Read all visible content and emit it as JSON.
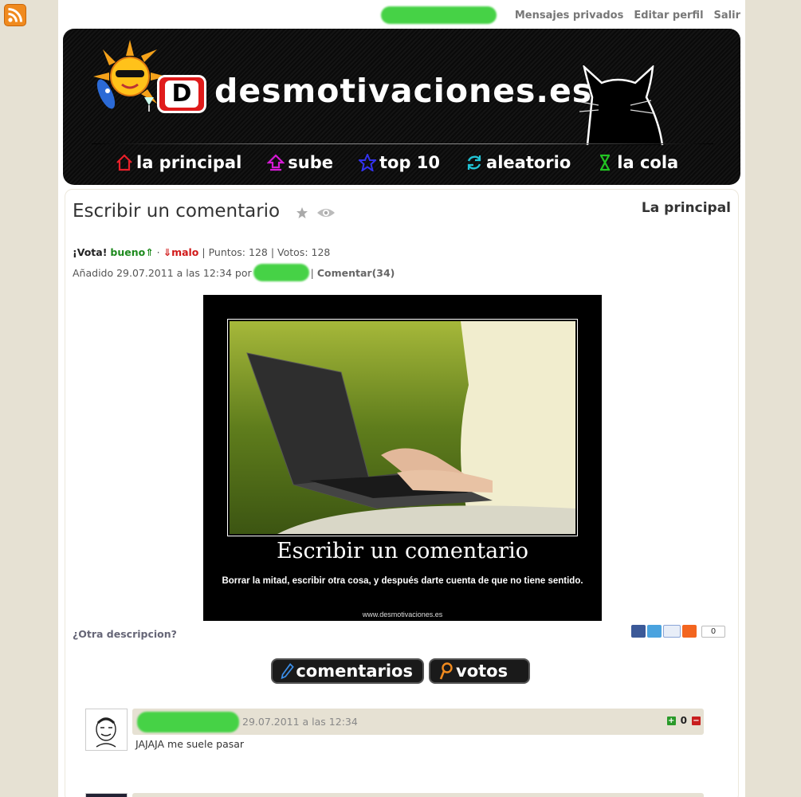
{
  "topbar": {
    "links": [
      "Mensajes privados",
      "Editar perfil",
      "Salir"
    ]
  },
  "header": {
    "logo_letter": "D",
    "site_name": "desmotivaciones.es",
    "nav": [
      {
        "label": "la principal",
        "icon": "home-icon",
        "color": "#e8202a"
      },
      {
        "label": "sube",
        "icon": "upload-icon",
        "color": "#d61ad6"
      },
      {
        "label": "top 10",
        "icon": "star-icon",
        "color": "#2222cc"
      },
      {
        "label": "aleatorio",
        "icon": "refresh-icon",
        "color": "#22c4d6"
      },
      {
        "label": "la cola",
        "icon": "hourglass-icon",
        "color": "#22c422"
      }
    ]
  },
  "post": {
    "title": "Escribir un comentario",
    "section_link": "La principal",
    "vote_prompt": "¡Vota!",
    "vote_good": "bueno⇑",
    "vote_bad": "⇓malo",
    "points": "Puntos: 128",
    "votes": "Votos: 128",
    "added_prefix": "Añadido 29.07.2011 a las 12:34 por",
    "comment_link": "Comentar(34)",
    "poster": {
      "title": "Escribir un comentario",
      "subtitle": "Borrar la mitad, escribir otra cosa, y después darte cuenta de que no tiene sentido.",
      "url": "www.desmotivaciones.es"
    },
    "other_description": "¿Otra descripcion?",
    "share_count": "0"
  },
  "tabs": {
    "comments": "comentarios",
    "votes": "votos"
  },
  "comments": [
    {
      "date": "29.07.2011 a las 12:34",
      "score": "0",
      "text": "JAJAJA me suele pasar"
    }
  ],
  "colors": {
    "background": "#e6e1d3",
    "good": "#1e8a1e",
    "bad": "#d11a1a",
    "comment_header": "#e6e1d3"
  }
}
